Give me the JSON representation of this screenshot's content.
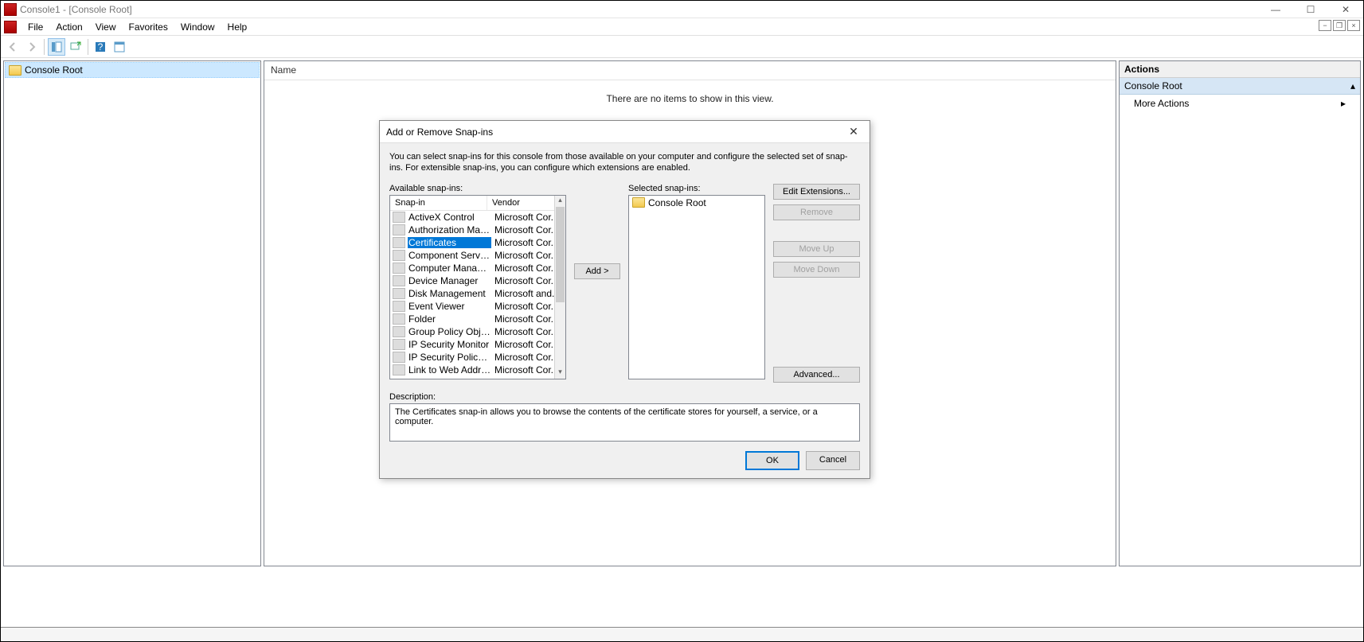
{
  "window": {
    "title": "Console1 - [Console Root]"
  },
  "menu": {
    "file": "File",
    "action": "Action",
    "view": "View",
    "favorites": "Favorites",
    "window": "Window",
    "help": "Help"
  },
  "tree": {
    "root": "Console Root"
  },
  "content": {
    "name_header": "Name",
    "empty_message": "There are no items to show in this view."
  },
  "actions": {
    "header": "Actions",
    "section": "Console Root",
    "more": "More Actions"
  },
  "dialog": {
    "title": "Add or Remove Snap-ins",
    "intro": "You can select snap-ins for this console from those available on your computer and configure the selected set of snap-ins. For extensible snap-ins, you can configure which extensions are enabled.",
    "available_label": "Available snap-ins:",
    "selected_label": "Selected snap-ins:",
    "col_snapin": "Snap-in",
    "col_vendor": "Vendor",
    "add_btn": "Add >",
    "edit_btn": "Edit Extensions...",
    "remove_btn": "Remove",
    "moveup_btn": "Move Up",
    "movedown_btn": "Move Down",
    "advanced_btn": "Advanced...",
    "description_label": "Description:",
    "description_text": "The Certificates snap-in allows you to browse the contents of the certificate stores for yourself, a service, or a computer.",
    "ok": "OK",
    "cancel": "Cancel",
    "selected_root": "Console Root",
    "available": [
      {
        "name": "ActiveX Control",
        "vendor": "Microsoft Cor..."
      },
      {
        "name": "Authorization Manager",
        "vendor": "Microsoft Cor..."
      },
      {
        "name": "Certificates",
        "vendor": "Microsoft Cor...",
        "selected": true
      },
      {
        "name": "Component Services",
        "vendor": "Microsoft Cor..."
      },
      {
        "name": "Computer Managem...",
        "vendor": "Microsoft Cor..."
      },
      {
        "name": "Device Manager",
        "vendor": "Microsoft Cor..."
      },
      {
        "name": "Disk Management",
        "vendor": "Microsoft and..."
      },
      {
        "name": "Event Viewer",
        "vendor": "Microsoft Cor..."
      },
      {
        "name": "Folder",
        "vendor": "Microsoft Cor..."
      },
      {
        "name": "Group Policy Object ...",
        "vendor": "Microsoft Cor..."
      },
      {
        "name": "IP Security Monitor",
        "vendor": "Microsoft Cor..."
      },
      {
        "name": "IP Security Policy M...",
        "vendor": "Microsoft Cor..."
      },
      {
        "name": "Link to Web Address",
        "vendor": "Microsoft Cor..."
      }
    ]
  }
}
